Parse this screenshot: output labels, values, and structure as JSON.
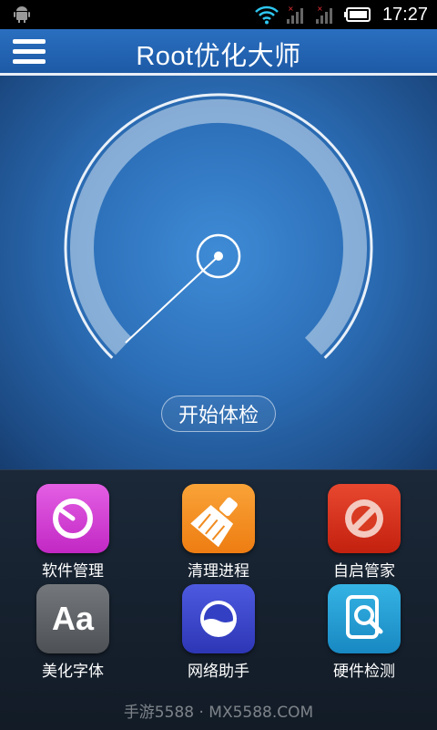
{
  "status_bar": {
    "time": "17:27",
    "icons": [
      "android-icon",
      "wifi-icon",
      "signal-icon",
      "signal-icon",
      "battery-icon"
    ]
  },
  "header": {
    "title": "Root优化大师",
    "menu_icon": "menu-icon"
  },
  "gauge": {
    "start_label": "开始体检"
  },
  "tools": [
    {
      "label": "软件管理",
      "icon": "app-manager-icon",
      "color": "#d93fd6"
    },
    {
      "label": "清理进程",
      "icon": "broom-icon",
      "color": "#f28a1c"
    },
    {
      "label": "自启管家",
      "icon": "block-icon",
      "color": "#d8301c"
    },
    {
      "label": "美化字体",
      "icon": "font-icon",
      "color": "#5e6266"
    },
    {
      "label": "网络助手",
      "icon": "network-icon",
      "color": "#3a45c8"
    },
    {
      "label": "硬件检测",
      "icon": "hardware-search-icon",
      "color": "#1f9cd4"
    }
  ],
  "watermark": "手游5588 · MX5588.COM"
}
